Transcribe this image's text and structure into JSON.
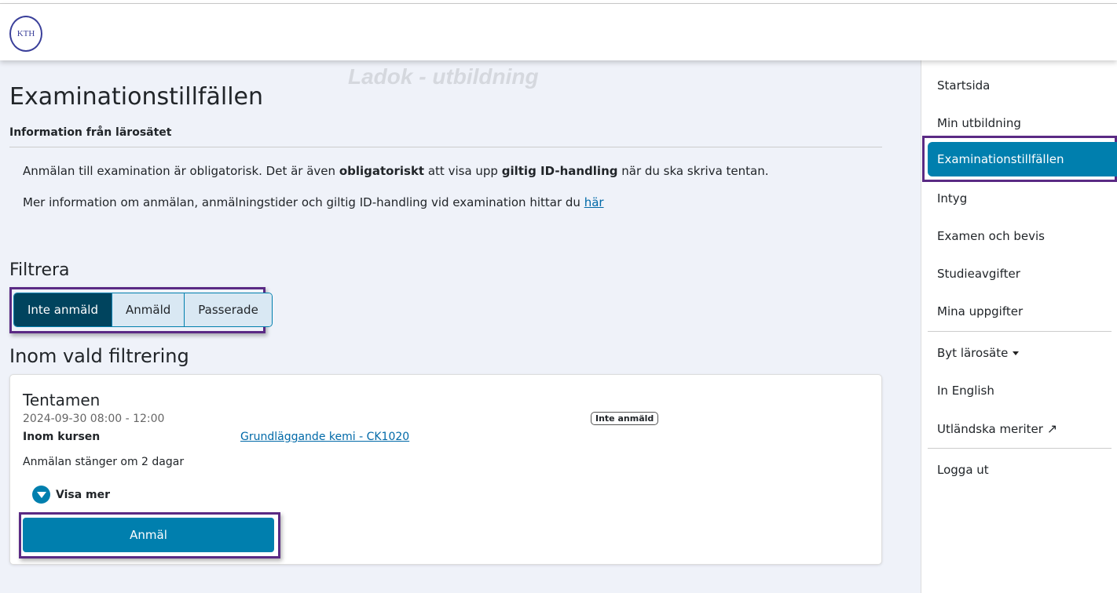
{
  "header": {
    "logo_text": "KTH",
    "watermark": "Ladok - utbildning"
  },
  "page": {
    "title": "Examinationstillfällen",
    "info_title": "Information från lärosätet",
    "info_p1_a": "Anmälan till examination är obligatorisk. Det är även ",
    "info_p1_b": "obligatoriskt",
    "info_p1_c": " att visa upp ",
    "info_p1_d": "giltig ID-handling",
    "info_p1_e": " när du ska skriva tentan.",
    "info_p2": "Mer information om anmälan, anmälningstider och giltig ID-handling vid examination hittar du ",
    "info_link": "här"
  },
  "filter": {
    "title": "Filtrera",
    "options": [
      "Inte anmäld",
      "Anmäld",
      "Passerade"
    ],
    "selected": "Inte anmäld"
  },
  "results": {
    "title": "Inom vald filtrering",
    "card": {
      "title": "Tentamen",
      "datetime": "2024-09-30 08:00 - 12:00",
      "badge": "Inte anmäld",
      "course_label": "Inom kursen",
      "course_link": "Grundläggande kemi - CK1020",
      "closing": "Anmälan stänger om 2 dagar",
      "show_more": "Visa mer",
      "register_button": "Anmäl"
    }
  },
  "sidebar": {
    "items": [
      "Startsida",
      "Min utbildning",
      "Examinationstillfällen",
      "Intyg",
      "Examen och bevis",
      "Studieavgifter",
      "Mina uppgifter",
      "Byt lärosäte",
      "In English",
      "Utländska meriter",
      "Logga ut"
    ],
    "active": "Examinationstillfällen"
  },
  "colors": {
    "accent": "#007fae",
    "dark": "#00445e",
    "highlight": "#5a2a84"
  }
}
